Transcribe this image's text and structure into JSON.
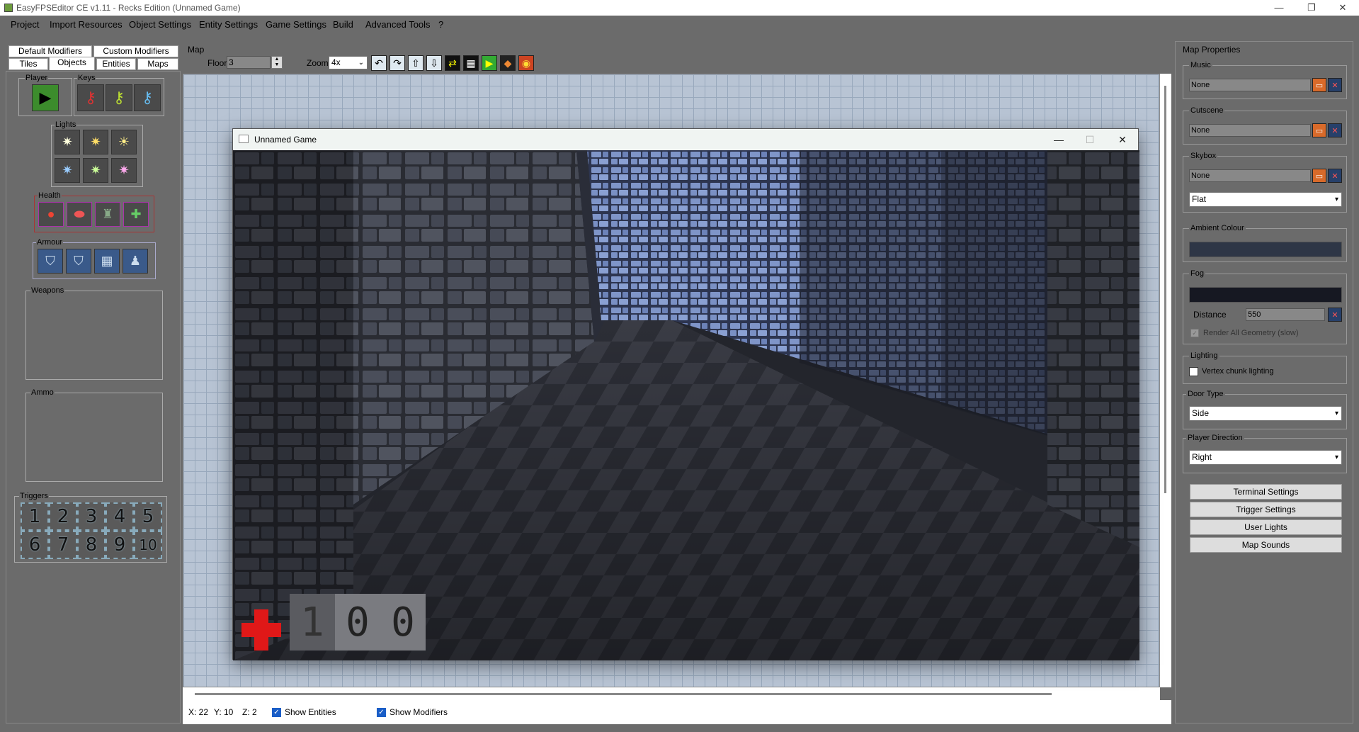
{
  "window": {
    "title": "EasyFPSEditor CE v1.11 - Recks Edition (Unnamed Game)",
    "minimize": "—",
    "maximize": "❐",
    "close": "✕"
  },
  "menu": [
    "Project",
    "Import Resources",
    "Object Settings",
    "Entity Settings",
    "Game Settings",
    "Build",
    "Advanced Tools",
    "?"
  ],
  "left": {
    "tabs_row1": [
      "Default Modifiers",
      "Custom Modifiers"
    ],
    "tabs_row2": [
      "Tiles",
      "Objects",
      "Entities",
      "Maps"
    ],
    "groups": {
      "player": "Player",
      "keys": "Keys",
      "lights": "Lights",
      "health": "Health",
      "armour": "Armour",
      "weapons": "Weapons",
      "ammo": "Ammo",
      "triggers": "Triggers"
    },
    "triggers": [
      "1",
      "2",
      "3",
      "4",
      "5",
      "6",
      "7",
      "8",
      "9",
      "10"
    ]
  },
  "map": {
    "label": "Map",
    "floor_label": "Floor",
    "floor_value": "3",
    "zoom_label": "Zoom",
    "zoom_value": "4x",
    "toolbar_icons": [
      "rotate-left-icon",
      "rotate-right-icon",
      "move-up-icon",
      "move-down-icon",
      "swap-icon",
      "grid-icon",
      "play-icon",
      "palette-icon",
      "color-wheel-icon"
    ]
  },
  "game_window": {
    "title": "Unnamed Game",
    "minimize": "—",
    "maximize": "☐",
    "close": "✕",
    "health_digits": [
      "1",
      "0",
      "0"
    ]
  },
  "status": {
    "x": "X: 22",
    "y": "Y: 10",
    "z": "Z: 2",
    "show_entities": "Show Entities",
    "show_modifiers": "Show Modifiers"
  },
  "right": {
    "title": "Map Properties",
    "music_label": "Music",
    "music_value": "None",
    "cutscene_label": "Cutscene",
    "cutscene_value": "None",
    "skybox_label": "Skybox",
    "skybox_value": "None",
    "skybox_mode": "Flat",
    "ambient_label": "Ambient Colour",
    "fog_label": "Fog",
    "distance_label": "Distance",
    "distance_value": "550",
    "render_all": "Render All Geometry (slow)",
    "lighting_label": "Lighting",
    "vertex_chunk": "Vertex chunk lighting",
    "door_type_label": "Door Type",
    "door_type_value": "Side",
    "player_dir_label": "Player Direction",
    "player_dir_value": "Right",
    "buttons": [
      "Terminal Settings",
      "Trigger Settings",
      "User Lights",
      "Map Sounds"
    ]
  },
  "colors": {
    "ambient": "#2e3646",
    "fog": "#161822",
    "chrome": "#6b6b6b"
  }
}
